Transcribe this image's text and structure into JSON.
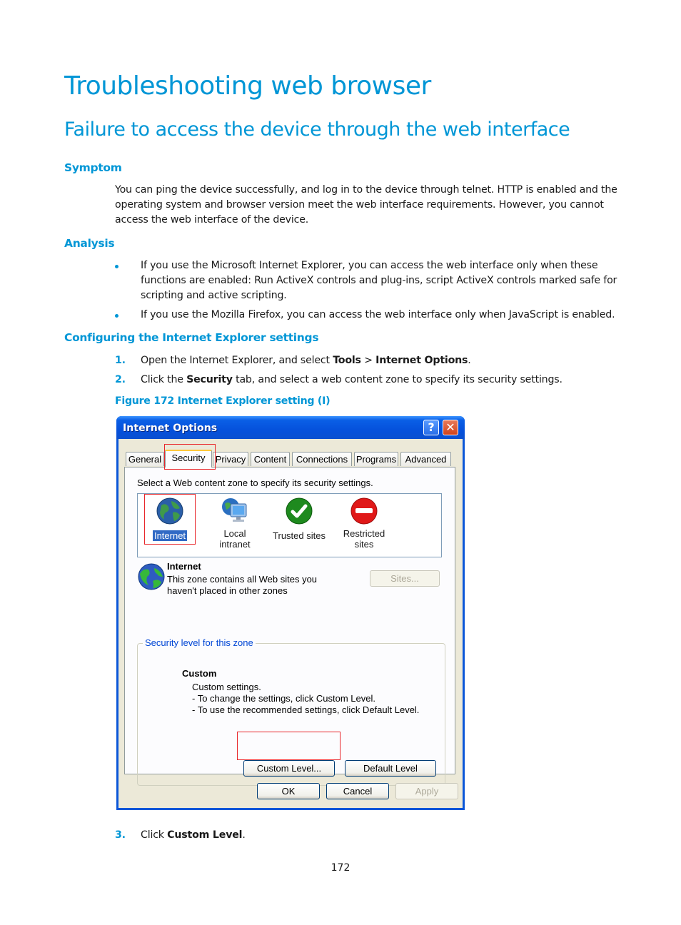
{
  "document": {
    "title": "Troubleshooting web browser",
    "section_title": "Failure to access the device through the web interface",
    "symptom": {
      "heading": "Symptom",
      "text": "You can ping the device successfully, and log in to the device through telnet. HTTP is enabled and the operating system and browser version meet the web interface requirements. However, you cannot access the web interface of the device."
    },
    "analysis": {
      "heading": "Analysis",
      "bullets": [
        "If you use the Microsoft Internet Explorer, you can access the web interface only when these functions are enabled: Run ActiveX controls and plug-ins, script ActiveX controls marked safe for scripting and active scripting.",
        "If you use the Mozilla Firefox, you can access the web interface only when JavaScript is enabled."
      ]
    },
    "configuring": {
      "heading": "Configuring the Internet Explorer settings",
      "steps": [
        {
          "num": "1.",
          "pre": "Open the Internet Explorer, and select ",
          "b1": "Tools",
          "mid": " > ",
          "b2": "Internet Options",
          "post": "."
        },
        {
          "num": "2.",
          "pre": "Click the ",
          "b1": "Security",
          "mid": " tab, and select a web content zone to specify its security settings.",
          "b2": "",
          "post": ""
        },
        {
          "num": "3.",
          "pre": "Click ",
          "b1": "Custom Level",
          "mid": ".",
          "b2": "",
          "post": ""
        }
      ],
      "figure_caption": "Figure 172 Internet Explorer setting (I)"
    },
    "page_number": "172"
  },
  "dialog": {
    "title": "Internet Options",
    "help_button": "?",
    "close_button": "✕",
    "tabs": [
      "General",
      "Security",
      "Privacy",
      "Content",
      "Connections",
      "Programs",
      "Advanced"
    ],
    "active_tab": "Security",
    "zone_prompt": "Select a Web content zone to specify its security settings.",
    "zones": [
      {
        "label": "Internet",
        "icon": "globe-icon",
        "selected": true
      },
      {
        "label": "Local intranet",
        "icon": "intranet-icon",
        "selected": false
      },
      {
        "label": "Trusted sites",
        "icon": "check-icon",
        "selected": false
      },
      {
        "label": "Restricted sites",
        "icon": "no-entry-icon",
        "selected": false
      }
    ],
    "zone_info": {
      "name": "Internet",
      "description_line1": "This zone contains all Web sites you",
      "description_line2": "haven't placed in other zones",
      "sites_button": "Sites..."
    },
    "security_level": {
      "legend": "Security level for this zone",
      "level_name": "Custom",
      "line1": "Custom settings.",
      "line2": "- To change the settings, click Custom Level.",
      "line3": "- To use the recommended settings, click Default Level.",
      "custom_level_button": "Custom Level...",
      "default_level_button": "Default Level"
    },
    "footer": {
      "ok": "OK",
      "cancel": "Cancel",
      "apply": "Apply"
    },
    "colors": {
      "title_bar": "#0551dc",
      "highlight_box": "#e8262a",
      "selection": "#316ac5"
    }
  }
}
